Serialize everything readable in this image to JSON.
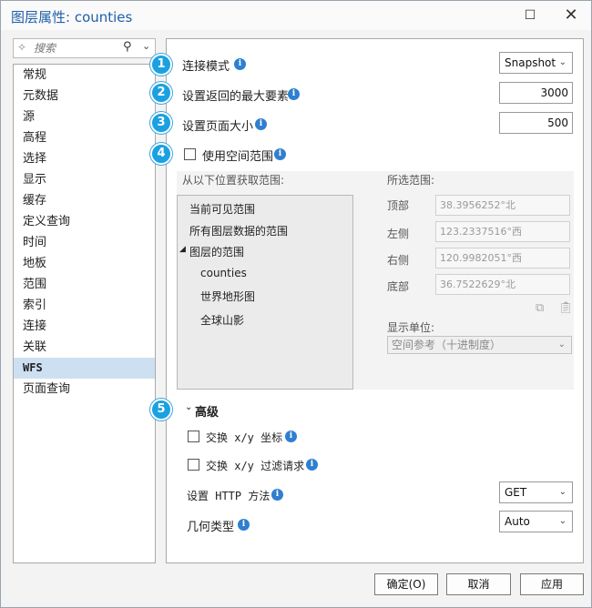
{
  "window": {
    "title": "图层属性: counties"
  },
  "search": {
    "placeholder": "搜索"
  },
  "sidebar": {
    "items": [
      "常规",
      "元数据",
      "源",
      "高程",
      "选择",
      "显示",
      "缓存",
      "定义查询",
      "时间",
      "地板",
      "范围",
      "索引",
      "连接",
      "关联",
      "WFS",
      "页面查询"
    ],
    "active_index": 14
  },
  "settings": {
    "connection_mode": {
      "badge": "1",
      "label": "连接模式",
      "value": "Snapshot"
    },
    "max_features": {
      "badge": "2",
      "label": "设置返回的最大要素",
      "value": "3000"
    },
    "page_size": {
      "badge": "3",
      "label": "设置页面大小",
      "value": "500"
    },
    "spatial_extent": {
      "badge": "4",
      "label": "使用空间范围",
      "checked": false
    }
  },
  "extent": {
    "source_label": "从以下位置获取范围:",
    "tree": {
      "current_visible": "当前可见范围",
      "all_layers": "所有图层数据的范围",
      "layer_extent": "图层的范围",
      "children": [
        "counties",
        "世界地形图",
        "全球山影"
      ]
    },
    "selected_label": "所选范围:",
    "top": {
      "label": "顶部",
      "value": "38.3956252°北"
    },
    "left": {
      "label": "左侧",
      "value": "123.2337516°西"
    },
    "right": {
      "label": "右侧",
      "value": "120.9982051°西"
    },
    "bottom": {
      "label": "底部",
      "value": "36.7522629°北"
    },
    "units_label": "显示单位:",
    "units_value": "空间参考（十进制度）"
  },
  "advanced": {
    "badge": "5",
    "label": "高级",
    "swap_xy": {
      "label": "交换 x/y 坐标",
      "checked": false
    },
    "swap_xy_filter": {
      "label": "交换 x/y 过滤请求",
      "checked": false
    },
    "http_method": {
      "label": "设置 HTTP 方法",
      "value": "GET"
    },
    "geometry_type": {
      "label": "几何类型",
      "value": "Auto"
    }
  },
  "footer": {
    "ok": "确定(O)",
    "cancel": "取消",
    "apply": "应用"
  },
  "colors": {
    "accent": "#1ba1e2",
    "title": "#1f5fa8",
    "selected": "#cde0f2"
  }
}
